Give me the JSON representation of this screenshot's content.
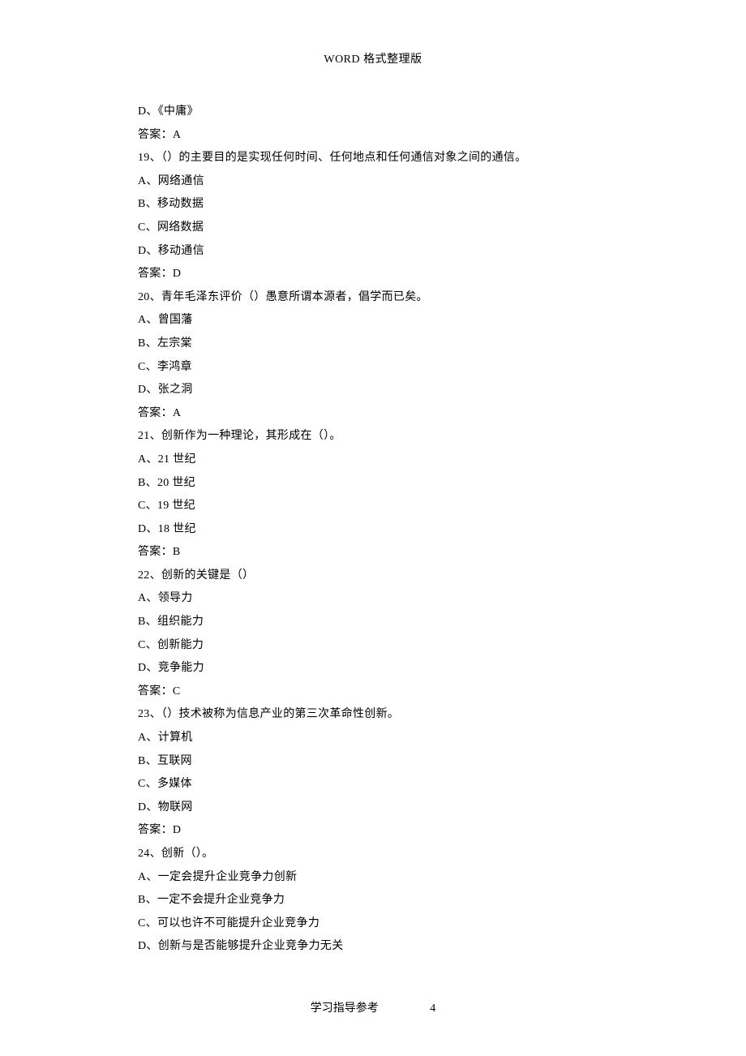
{
  "header": "WORD 格式整理版",
  "footer": {
    "text": "学习指导参考",
    "page": "4"
  },
  "lines": [
    "D、《中庸》",
    "答案：A",
    "19、（）的主要目的是实现任何时间、任何地点和任何通信对象之间的通信。",
    "A、网络通信",
    "B、移动数据",
    "C、网络数据",
    "D、移动通信",
    "答案：D",
    "20、青年毛泽东评价（）愚意所谓本源者，倡学而已矣。",
    "A、曾国藩",
    "B、左宗棠",
    "C、李鸿章",
    "D、张之洞",
    "答案：A",
    "21、创新作为一种理论，其形成在（）。",
    "A、21 世纪",
    "B、20 世纪",
    "C、19 世纪",
    "D、18 世纪",
    "答案：B",
    "22、创新的关键是（）",
    "A、领导力",
    "B、组织能力",
    "C、创新能力",
    "D、竞争能力",
    "答案：C",
    "23、（）技术被称为信息产业的第三次革命性创新。",
    "A、计算机",
    "B、互联网",
    "C、多媒体",
    "D、物联网",
    "答案：D",
    "24、创新（）。",
    "A、一定会提升企业竞争力创新",
    "B、一定不会提升企业竞争力",
    "C、可以也许不可能提升企业竞争力",
    "D、创新与是否能够提升企业竞争力无关"
  ]
}
